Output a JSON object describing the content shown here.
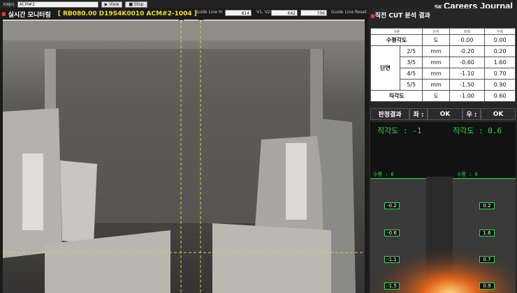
{
  "topbar": {
    "cam_label": "카메라",
    "cam_select": "ACM#2",
    "view_label": "▶ View",
    "stop_label": "■ Stop"
  },
  "brand": {
    "small": "SK",
    "main": "Careers Journal"
  },
  "monitor": {
    "title": "실시간 모니터링",
    "code": "[  RB080.00  D19S4K0010  ACM#2-1004  ]",
    "guide_line_label": "Guide Line",
    "h_label": "H:",
    "h_value": "814",
    "v_label": "V1, V2:",
    "v1_value": "642",
    "v2_value": "706",
    "reset_label": "Guide Line Reset"
  },
  "analysis": {
    "title": "직전 CUT 분석 결과",
    "headers": [
      "구분",
      "단위",
      "좌측",
      "우측"
    ],
    "rows": [
      {
        "group": "수평각도",
        "sub": "",
        "unit": "도",
        "left": "0.00",
        "right": "0.00"
      },
      {
        "group": "단면",
        "sub": "2/5",
        "unit": "mm",
        "left": "-0.20",
        "right": "0.20"
      },
      {
        "group": "",
        "sub": "3/5",
        "unit": "mm",
        "left": "-0.60",
        "right": "1.60"
      },
      {
        "group": "",
        "sub": "4/5",
        "unit": "mm",
        "left": "-1.10",
        "right": "0.70"
      },
      {
        "group": "",
        "sub": "5/5",
        "unit": "mm",
        "left": "-1.50",
        "right": "0.90"
      },
      {
        "group": "직각도",
        "sub": "",
        "unit": "도",
        "left": "-1.00",
        "right": "0.60"
      }
    ]
  },
  "judgement": {
    "label": "판정결과",
    "left_label": "좌 :",
    "left_value": "OK",
    "right_label": "우 :",
    "right_value": "OK"
  },
  "thermal": {
    "left_angle": "직각도 : -1",
    "right_angle": "직각도 : 0.6",
    "left_level": "수평 : 0",
    "right_level": "수평 : 0",
    "left_tags": [
      "-0.2",
      "-0.6",
      "-1.1",
      "-1.5"
    ],
    "right_tags": [
      "0.2",
      "1.6",
      "0.7",
      "0.9"
    ]
  },
  "colors": {
    "accent": "#f0e020",
    "overlay": "#23e045"
  }
}
